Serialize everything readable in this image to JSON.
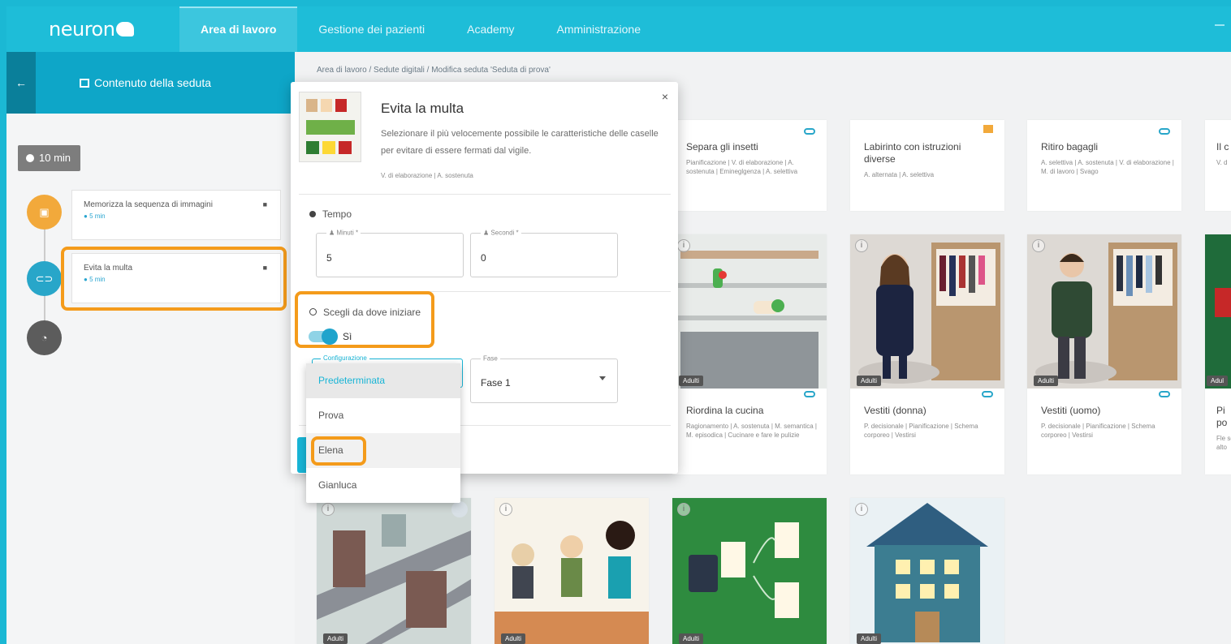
{
  "app": {
    "logo_text": "neuron"
  },
  "nav": {
    "items": [
      "Area di lavoro",
      "Gestione dei pazienti",
      "Academy",
      "Amministrazione"
    ],
    "active": "Area di lavoro"
  },
  "sidebar": {
    "title": "Contenuto della seduta",
    "duration": "10 min",
    "activities": [
      {
        "title": "Memorizza la sequenza di immagini",
        "duration": "5 min",
        "color": "#f2a93b"
      },
      {
        "title": "Evita la multa",
        "duration": "5 min",
        "color": "#28a6c9"
      }
    ]
  },
  "breadcrumb": "Area di lavoro  /  Sedute digitali  /  Modifica seduta 'Seduta di prova'",
  "exercises": [
    {
      "title": "Separa gli insetti",
      "tags": "Pianificazione | V. di elaborazione | A. sostenuta | Emineglgenza | A. selettiva"
    },
    {
      "title": "Labirinto con istruzioni diverse",
      "tags": "A. alternata | A. selettiva"
    },
    {
      "title": "Ritiro bagagli",
      "tags": "A. selettiva | A. sostenuta | V. di elaborazione | M. di lavoro | Svago"
    },
    {
      "title": "Il c",
      "tags": "V. d"
    },
    {
      "title": "Riordina la cucina",
      "tags": "Ragionamento | A. sostenuta | M. semantica | M. episodica | Cucinare e fare le pulizie",
      "badge": "Adulti"
    },
    {
      "title": "Vestiti (donna)",
      "tags": "P. decisionale | Pianificazione | Schema corporeo | Vestirsi",
      "badge": "Adulti"
    },
    {
      "title": "Vestiti (uomo)",
      "tags": "P. decisionale | Pianificazione | Schema corporeo | Vestirsi",
      "badge": "Adulti"
    },
    {
      "title": "Pi po",
      "tags": "Fle sel alto",
      "badge": "Adul"
    }
  ],
  "bottom_badges": [
    "Adulti",
    "Adulti",
    "Adulti",
    "Adulti"
  ],
  "modal": {
    "title": "Evita la multa",
    "description": "Selezionare il più velocemente possibile le caratteristiche delle caselle per evitare di essere fermati dal vigile.",
    "tags": "V. di elaborazione | A. sostenuta",
    "close_label": "×",
    "time_section": "Tempo",
    "minutes_label": "Minuti *",
    "minutes_value": "5",
    "seconds_label": "Secondi *",
    "seconds_value": "0",
    "start_section": "Scegli da dove iniziare",
    "toggle_label": "Sì",
    "toggle_on": true,
    "config_label": "Configurazione",
    "phase_label": "Fase",
    "phase_value": "Fase 1"
  },
  "dropdown": {
    "options": [
      "Predeterminata",
      "Prova",
      "Elena",
      "Gianluca"
    ],
    "selected": "Predeterminata",
    "hovered": "Elena"
  },
  "colors": {
    "primary": "#1ebdd8",
    "accent_highlight": "#f49b1b",
    "sidebar_head": "#0ea6c8"
  }
}
